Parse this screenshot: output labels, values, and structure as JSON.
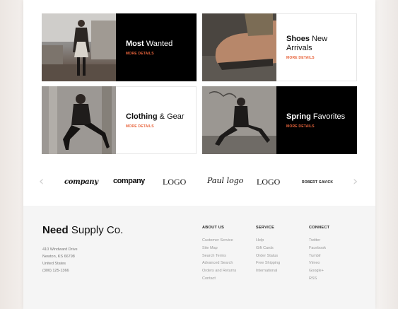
{
  "tiles": [
    {
      "title_bold": "Most",
      "title_rest": "Wanted",
      "more": "MORE DETAILS"
    },
    {
      "title_bold": "Shoes",
      "title_rest": "New",
      "title_line2": "Arrivals",
      "more": "MORE DETAILS"
    },
    {
      "title_bold": "Clothing",
      "title_rest": "& Gear",
      "more": "MORE DETAILS"
    },
    {
      "title_bold": "Spring",
      "title_rest": "Favorites",
      "more": "MORE DETAILS"
    }
  ],
  "logos": [
    "company",
    "company",
    "LOGO",
    "Paul logo",
    "LOGO",
    "ROBERT GAVICK"
  ],
  "carousel": {
    "prev": "‹",
    "next": "›"
  },
  "footer": {
    "brand_bold": "Need",
    "brand_rest": "Supply Co.",
    "address": [
      "410 Windward Drive",
      "Newton, KS 66798",
      "United States",
      "(300) 125-1366"
    ],
    "columns": [
      {
        "title": "ABOUT US",
        "links": [
          "Customer Service",
          "Site Map",
          "Search Terms",
          "Advanced Search",
          "Orders and Returns",
          "Contact"
        ]
      },
      {
        "title": "SERVICE",
        "links": [
          "Help",
          "Gift Cards",
          "Order Status",
          "Free Shipping",
          "International"
        ]
      },
      {
        "title": "CONNECT",
        "links": [
          "Twitter",
          "Facebook",
          "Tumblr",
          "Vimeo",
          "Google+",
          "RSS"
        ]
      }
    ]
  },
  "colors": {
    "accent": "#e8643c",
    "dark_panel": "#000000",
    "footer_bg": "#f5f5f5"
  }
}
